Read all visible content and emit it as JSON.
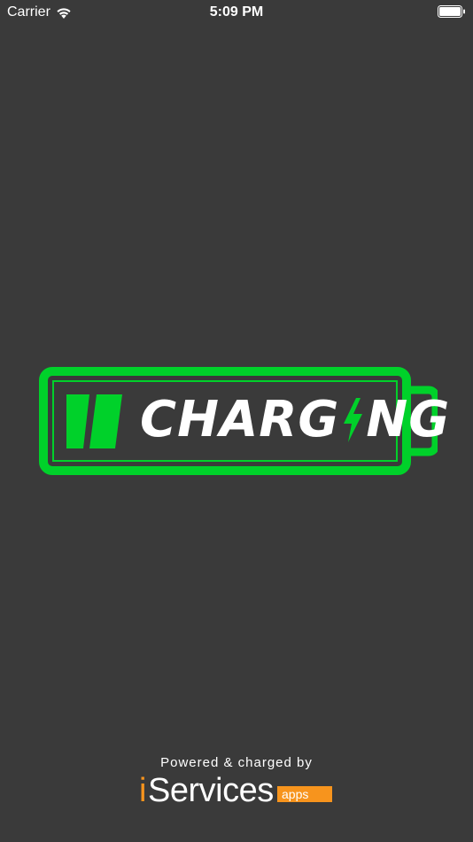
{
  "status_bar": {
    "carrier": "Carrier",
    "time": "5:09 PM",
    "wifi_icon": "wifi-icon",
    "battery_icon": "battery-icon"
  },
  "logo": {
    "word_prefix": "CHARG",
    "word_suffix": "NG",
    "bolt_icon": "lightning-bolt-icon",
    "colors": {
      "accent": "#00d12a",
      "text": "#ffffff",
      "background": "#3a3a3a"
    }
  },
  "footer": {
    "powered_by": "Powered & charged by",
    "brand_i": "i",
    "brand_name": "Services",
    "brand_suffix": "apps",
    "brand_accent": "#f7941d"
  }
}
